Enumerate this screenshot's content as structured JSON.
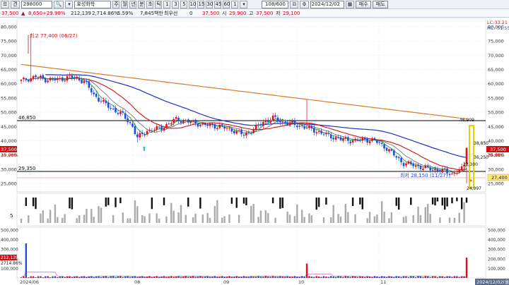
{
  "toolbar": {
    "stock_code": "298000",
    "stock_name": "효성화학",
    "chart_types": [
      "주",
      "월",
      "년",
      "분",
      "초",
      "틱"
    ],
    "intervals": [
      "1",
      "3",
      "5",
      "10",
      "15",
      "30",
      "45",
      "60",
      "1"
    ],
    "count": "108/600",
    "date": "2024/12/02",
    "buy_label": "매수",
    "sell_label": "매도"
  },
  "quote": {
    "price": "37,500",
    "change": "8,650",
    "change_pct": "+29.98%",
    "volume": "212,139",
    "volume_pct": "2,714.86%",
    "turnover": "5.59%",
    "amount": "7,845백만",
    "priority_label": "최우선",
    "priority_value": "0",
    "close_value": "37,500",
    "open_label": "시",
    "open_value": "29,900",
    "high_label": "고",
    "high_value": "37,500",
    "low_label": "저",
    "low_value": "29,100"
  },
  "price_axis": [
    "80,000",
    "75,000",
    "70,000",
    "65,000",
    "60,000",
    "55,000",
    "50,000",
    "45,000",
    "40,000",
    "35,000",
    "30,000",
    "25,000"
  ],
  "axis_labels": {
    "lc": "LC:33.21",
    "hc": "HC:-51.55",
    "left_price_tag": "37,500",
    "left_pct_tag": "29.98%",
    "left_bottom_price": "27,400",
    "right_price_tag": "37,500",
    "right_pct_tag": "29.98%",
    "right_bottom_tag": "27,400"
  },
  "annotations": {
    "high_marker": "최고 77,400 (06/27)",
    "low_marker": "최저 28,150 (11/27)",
    "level_upper": "46,850",
    "level_lower": "29,350",
    "level_upper_right": "46,909",
    "ref_38": "38,850",
    "ref_33": "33,300",
    "ref_36": "36,250",
    "bottom_val": "24,997"
  },
  "indicator_axis": [
    "5"
  ],
  "volume_axis": [
    "500,000",
    "400,000",
    "300,000",
    "200,000",
    "100,000"
  ],
  "volume_tags": {
    "v1": "212,139",
    "v2": "2714.86%"
  },
  "date_axis": [
    "2024/06",
    "08",
    "09",
    "10",
    "11"
  ],
  "date_cursor": "2024/12/02(월)",
  "colors": {
    "up": "#e0101f",
    "down": "#1f4fd8",
    "ma5": "#18a04a",
    "ma20": "#d01010",
    "ma60": "#2030c0",
    "ma120": "#d97a2b",
    "volume_bar": "#9a9a9a"
  }
}
